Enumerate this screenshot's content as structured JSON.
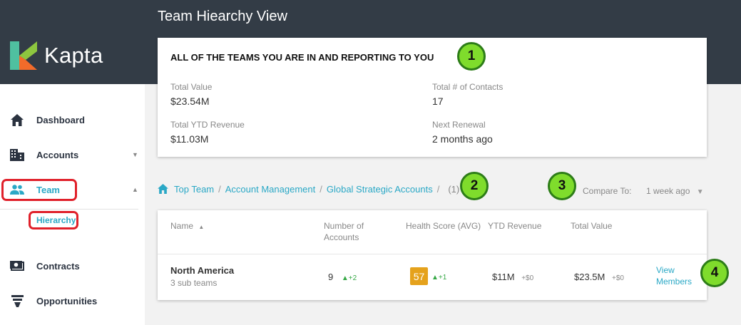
{
  "app": {
    "brand_name": "Kapta",
    "page_title": "Team Hiearchy View",
    "colors": {
      "header_bg": "#333c46",
      "accent": "#2aa8c6",
      "badge_green": "#7fdc2c",
      "score_amber": "#e5a21c",
      "annotation_red": "#e0202a"
    }
  },
  "sidebar": {
    "items": [
      {
        "label": "Dashboard",
        "icon": "home-icon"
      },
      {
        "label": "Accounts",
        "icon": "building-icon"
      },
      {
        "label": "Team",
        "icon": "people-icon"
      },
      {
        "label": "Contracts",
        "icon": "cash-icon"
      },
      {
        "label": "Opportunities",
        "icon": "funnel-icon"
      }
    ],
    "sub_item": "Hierarchy"
  },
  "summary": {
    "heading": "ALL OF THE TEAMS YOU ARE IN AND REPORTING TO YOU",
    "total_value_label": "Total Value",
    "total_value": "$23.54M",
    "contacts_label": "Total # of Contacts",
    "contacts": "17",
    "ytd_label": "Total YTD Revenue",
    "ytd": "$11.03M",
    "renewal_label": "Next Renewal",
    "renewal": "2 months ago"
  },
  "breadcrumb": {
    "items": [
      "Top Team",
      "Account Management",
      "Global Strategic Accounts"
    ],
    "count": "(1)"
  },
  "compare": {
    "label": "Compare To:",
    "value": "1 week ago"
  },
  "table": {
    "headers": {
      "name": "Name",
      "accounts_1": "Number of",
      "accounts_2": "Accounts",
      "health": "Health Score (AVG)",
      "ytd": "YTD Revenue",
      "total": "Total Value"
    },
    "row": {
      "name": "North America",
      "subtitle": "3 sub teams",
      "accounts": "9",
      "accounts_delta": "+2",
      "health": "57",
      "health_delta": "+1",
      "ytd": "$11M",
      "ytd_delta": "+$0",
      "total": "$23.5M",
      "total_delta": "+$0",
      "action_1": "View",
      "action_2": "Members"
    }
  },
  "badges": [
    "1",
    "2",
    "3",
    "4"
  ]
}
